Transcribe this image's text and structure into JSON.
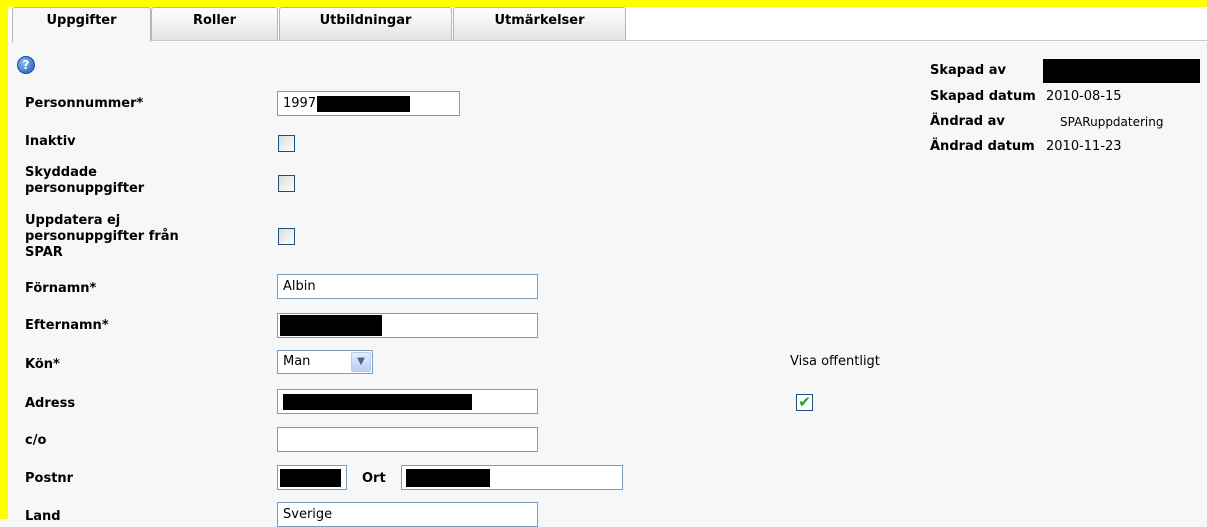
{
  "tabs": [
    {
      "label": "Uppgifter",
      "active": true
    },
    {
      "label": "Roller",
      "active": false
    },
    {
      "label": "Utbildningar",
      "active": false
    },
    {
      "label": "Utmärkelser",
      "active": false
    }
  ],
  "help_icon": "question-help-icon",
  "form": {
    "personnummer": {
      "label": "Personnummer",
      "value_prefix": "1997"
    },
    "inaktiv": {
      "label": "Inaktiv",
      "checked": false
    },
    "skyddade": {
      "label_line1": "Skyddade",
      "label_line2": "personuppgifter",
      "checked": false
    },
    "uppdatera": {
      "label_line1": "Uppdatera ej",
      "label_line2": "personuppgifter från",
      "label_line3": "SPAR",
      "checked": false
    },
    "fornamn": {
      "label": "Förnamn",
      "value": "Albin"
    },
    "efternamn": {
      "label": "Efternamn"
    },
    "kon": {
      "label": "Kön",
      "value": "Man"
    },
    "adress": {
      "label": "Adress"
    },
    "co": {
      "label": "c/o",
      "value": ""
    },
    "postnr": {
      "label": "Postnr"
    },
    "ort": {
      "label": "Ort"
    },
    "land": {
      "label": "Land",
      "value": "Sverige"
    },
    "required_marker": "*"
  },
  "visa_offentligt": {
    "label": "Visa offentligt",
    "checked": true
  },
  "meta": {
    "skapad_av": {
      "label": "Skapad av"
    },
    "skapad_datum": {
      "label": "Skapad datum",
      "value": "2010-08-15"
    },
    "andrad_av": {
      "label": "Ändrad av",
      "value": "SPARuppdatering"
    },
    "andrad_datum": {
      "label": "Ändrad datum",
      "value": "2010-11-23"
    }
  },
  "colors": {
    "frame": "#ffff00",
    "background": "#f7f7f7",
    "input_border": "#7f9db9",
    "check": "#21a121"
  }
}
